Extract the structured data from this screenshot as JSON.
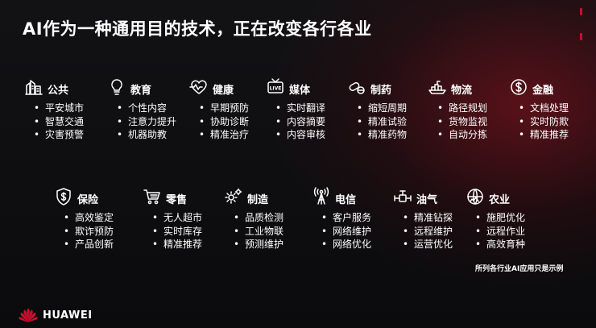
{
  "title": "AI作为一种通用目的技术，正在改变各行各业",
  "note": "所列各行业AI应用只是示例",
  "brand": "HUAWEI",
  "colors": {
    "accent": "#c8102e",
    "background": "#0c0c0e",
    "text": "#ffffff"
  },
  "rows": [
    {
      "categories": [
        {
          "name": "公共",
          "icon": "city-buildings-icon",
          "items": [
            "平安城市",
            "智慧交通",
            "灾害预警"
          ]
        },
        {
          "name": "教育",
          "icon": "lightbulb-icon",
          "items": [
            "个性内容",
            "注意力提升",
            "机器助教"
          ]
        },
        {
          "name": "健康",
          "icon": "heartbeat-icon",
          "items": [
            "早期预防",
            "协助诊断",
            "精准治疗"
          ]
        },
        {
          "name": "媒体",
          "icon": "live-tv-icon",
          "items": [
            "实时翻译",
            "内容摘要",
            "内容审核"
          ]
        },
        {
          "name": "制药",
          "icon": "pill-icon",
          "items": [
            "缩短周期",
            "精准试验",
            "精准药物"
          ]
        },
        {
          "name": "物流",
          "icon": "cargo-ship-icon",
          "items": [
            "路径规划",
            "货物监视",
            "自动分拣"
          ]
        },
        {
          "name": "金融",
          "icon": "bank-coin-icon",
          "items": [
            "文档处理",
            "实时防欺",
            "精准推荐"
          ]
        }
      ]
    },
    {
      "categories": [
        {
          "name": "保险",
          "icon": "shield-dollar-icon",
          "items": [
            "高效鉴定",
            "欺诈预防",
            "产品创新"
          ]
        },
        {
          "name": "零售",
          "icon": "shopping-cart-icon",
          "items": [
            "无人超市",
            "实时库存",
            "精准推荐"
          ]
        },
        {
          "name": "制造",
          "icon": "gears-icon",
          "items": [
            "品质检测",
            "工业物联",
            "预测维护"
          ]
        },
        {
          "name": "电信",
          "icon": "cell-tower-icon",
          "items": [
            "客户服务",
            "网络维护",
            "网络优化"
          ]
        },
        {
          "name": "油气",
          "icon": "pipeline-valve-icon",
          "items": [
            "精准钻探",
            "远程维护",
            "运营优化"
          ]
        },
        {
          "name": "农业",
          "icon": "globe-farm-icon",
          "items": [
            "施肥优化",
            "远程作业",
            "高效育种"
          ]
        }
      ]
    }
  ]
}
